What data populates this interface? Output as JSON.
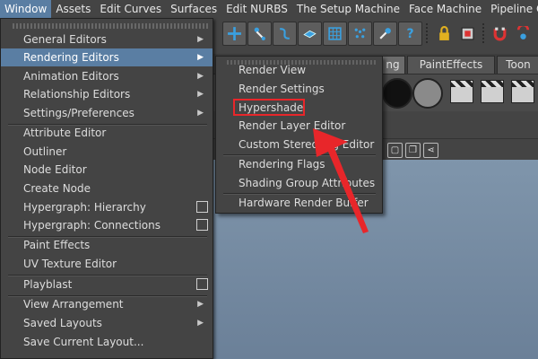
{
  "menubar": {
    "items": [
      "Window",
      "Assets",
      "Edit Curves",
      "Surfaces",
      "Edit NURBS",
      "The Setup Machine",
      "Face Machine",
      "Pipeline Cache"
    ]
  },
  "shelf": {
    "tabs": [
      "ng",
      "PaintEffects",
      "Toon"
    ],
    "current_tab": "ng"
  },
  "window_menu": {
    "items": [
      {
        "label": "General Editors",
        "submenu": true
      },
      {
        "label": "Rendering Editors",
        "submenu": true,
        "highlighted": true
      },
      {
        "label": "Animation Editors",
        "submenu": true
      },
      {
        "label": "Relationship Editors",
        "submenu": true
      },
      {
        "label": "Settings/Preferences",
        "submenu": true
      },
      {
        "label": "Attribute Editor"
      },
      {
        "label": "Outliner"
      },
      {
        "label": "Node Editor"
      },
      {
        "label": "Create Node"
      },
      {
        "label": "Hypergraph: Hierarchy",
        "option_box": true
      },
      {
        "label": "Hypergraph: Connections",
        "option_box": true
      },
      {
        "label": "Paint Effects"
      },
      {
        "label": "UV Texture Editor"
      },
      {
        "label": "Playblast",
        "option_box": true
      },
      {
        "label": "View Arrangement",
        "submenu": true
      },
      {
        "label": "Saved Layouts",
        "submenu": true
      },
      {
        "label": "Save Current Layout..."
      }
    ]
  },
  "rendering_editors_submenu": {
    "items": [
      {
        "label": "Render View"
      },
      {
        "label": "Render Settings"
      },
      {
        "label": "Hypershade",
        "annotated": true
      },
      {
        "label": "Render Layer Editor"
      },
      {
        "label": "Custom Stereo Rig Editor"
      },
      {
        "label": "Rendering Flags"
      },
      {
        "label": "Shading Group Attributes"
      },
      {
        "label": "Hardware Render Buffer"
      }
    ]
  },
  "colors": {
    "menu_bg": "#444444",
    "highlight": "#5a7ea3",
    "annotation": "#e8262a",
    "viewport": "#7f95ab"
  },
  "icons": {
    "toolbar": [
      "move-tool-icon",
      "joint-icon",
      "curve-icon",
      "plane-icon",
      "lattice-icon",
      "cluster-icon",
      "paint-icon",
      "help-icon",
      "lock-icon",
      "render-icon",
      "magnet-icon",
      "snap-icon"
    ]
  }
}
